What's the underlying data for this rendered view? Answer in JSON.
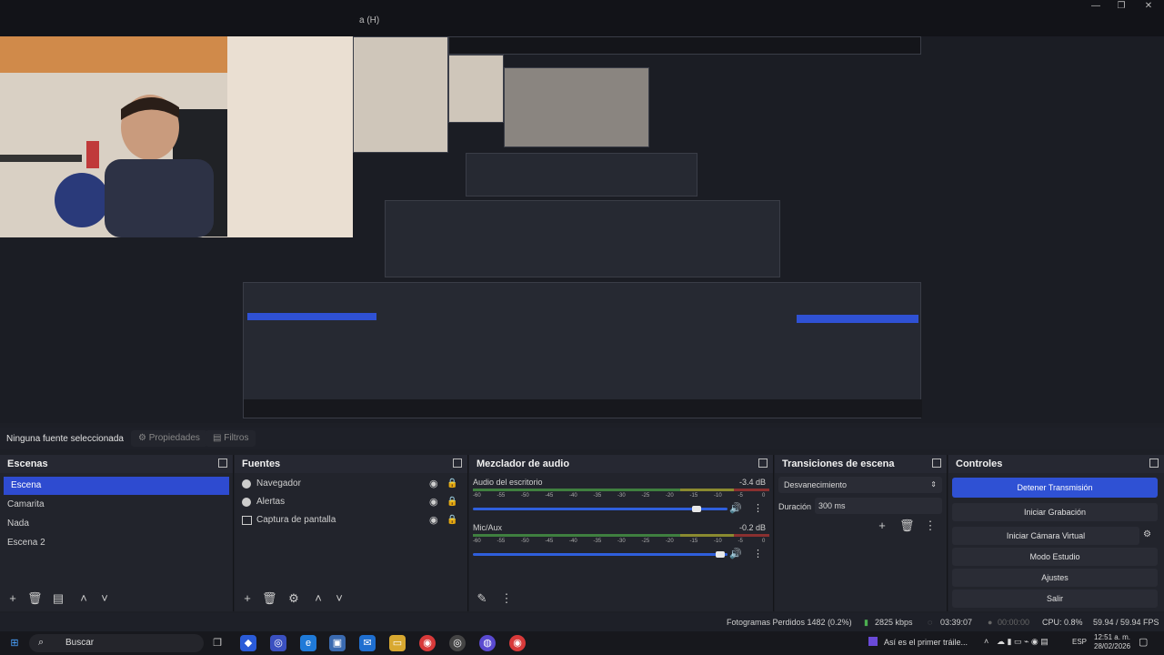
{
  "window": {
    "title": "a (H)"
  },
  "source_bar": {
    "none_selected": "Ninguna fuente seleccionada",
    "properties": "Propiedades",
    "filters": "Filtros"
  },
  "scenes": {
    "title": "Escenas",
    "items": [
      "Escena",
      "Camarita",
      "Nada",
      "Escena 2"
    ]
  },
  "sources": {
    "title": "Fuentes",
    "items": [
      "Navegador",
      "Alertas",
      "Captura de pantalla"
    ]
  },
  "mixer": {
    "title": "Mezclador de audio",
    "channels": [
      {
        "name": "Audio del escritorio",
        "db": "-3.4 dB",
        "volume": 0.88
      },
      {
        "name": "Mic/Aux",
        "db": "-0.2 dB",
        "volume": 0.97
      }
    ],
    "ticks": [
      "-60",
      "-55",
      "-50",
      "-45",
      "-40",
      "-35",
      "-30",
      "-25",
      "-20",
      "-15",
      "-10",
      "-5",
      "0"
    ]
  },
  "transitions": {
    "title": "Transiciones de escena",
    "selected": "Desvanecimiento",
    "duration_label": "Duración",
    "duration_value": "300 ms"
  },
  "controls": {
    "title": "Controles",
    "stop_stream": "Detener Transmisión",
    "start_record": "Iniciar Grabación",
    "start_vcam": "Iniciar Cámara Virtual",
    "studio_mode": "Modo Estudio",
    "settings": "Ajustes",
    "exit": "Salir"
  },
  "status": {
    "dropped": "Fotogramas Perdidos 1482 (0.2%)",
    "bitrate": "2825 kbps",
    "stream_time": "03:39:07",
    "rec_time": "00:00:00",
    "cpu": "CPU: 0.8%",
    "fps": "59.94 / 59.94 FPS"
  },
  "taskbar": {
    "search": "Buscar",
    "notification": "Así es el primer tráile...",
    "lang": "ESP",
    "time": "12:51 a. m.",
    "date": "28/02/2026"
  },
  "colors": {
    "accent": "#2f51d4",
    "bg": "#1d1f26",
    "panel": "#22242c"
  }
}
